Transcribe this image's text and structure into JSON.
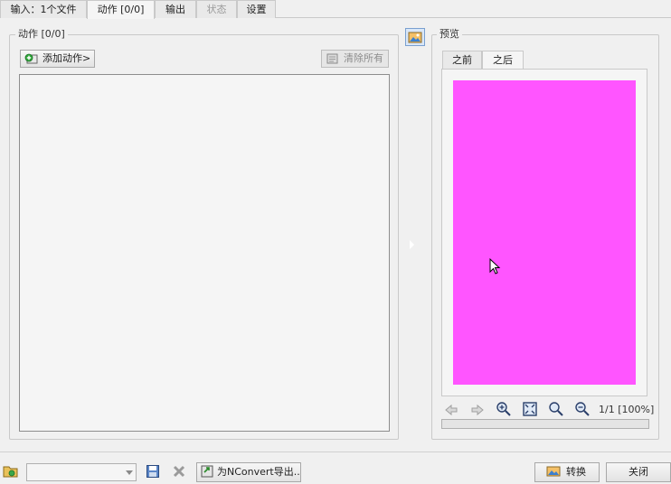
{
  "tabs": [
    {
      "label": "输入：1个文件",
      "active": false,
      "disabled": false
    },
    {
      "label": "动作 [0/0]",
      "active": true,
      "disabled": false
    },
    {
      "label": "输出",
      "active": false,
      "disabled": false
    },
    {
      "label": "状态",
      "active": false,
      "disabled": true
    },
    {
      "label": "设置",
      "active": false,
      "disabled": false
    }
  ],
  "actions_panel": {
    "title": "动作 [0/0]",
    "add_button": "添加动作>",
    "clear_button": "清除所有"
  },
  "preview_panel": {
    "title": "预览",
    "tabs": [
      "之前",
      "之后"
    ],
    "active_tab": "之后",
    "preview_color": "#ff55ff",
    "page_info": "1/1 [100%]",
    "icons": [
      "previous-icon",
      "next-icon",
      "zoom-in-icon",
      "fit-to-window-icon",
      "zoom-actual-icon",
      "zoom-out-icon"
    ]
  },
  "bottom": {
    "preset_value": "",
    "nconvert_button": "为NConvert导出...",
    "convert_button": "转换",
    "close_button": "关闭"
  },
  "colors": {
    "accent": "#ff55ff",
    "window_bg": "#f0f0f0"
  }
}
